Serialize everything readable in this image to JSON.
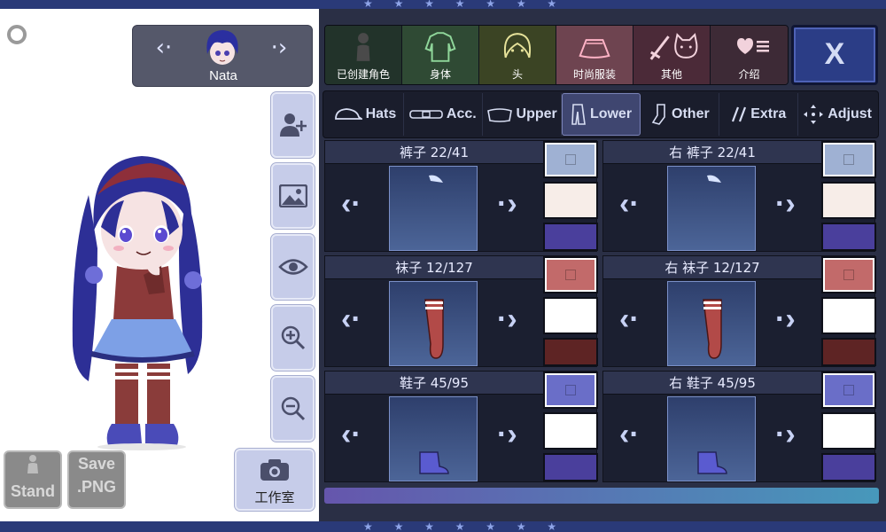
{
  "app": {
    "character_name": "Nata",
    "star_glyphs": "★ ★ ★ ★ ★ ★ ★"
  },
  "stage_buttons": {
    "stand_label": "Stand",
    "save_label_1": "Save",
    "save_label_2": ".PNG",
    "studio_label": "工作室"
  },
  "categories": [
    {
      "label": "已创建角色",
      "icon": "person-silhouette-icon",
      "bg": "#22332a"
    },
    {
      "label": "身体",
      "icon": "body-shirt-icon",
      "bg": "#2f4a34"
    },
    {
      "label": "头",
      "icon": "head-hair-icon",
      "bg": "#3b4424"
    },
    {
      "label": "时尚服装",
      "icon": "skirt-icon",
      "bg": "#6e4450"
    },
    {
      "label": "其他",
      "icon": "sword-cat-icon",
      "bg": "#4b2a38"
    },
    {
      "label": "介绍",
      "icon": "heart-list-icon",
      "bg": "#3d2a36"
    }
  ],
  "close_label": "X",
  "sub_tabs": [
    {
      "label": "Hats",
      "icon": "hat-icon"
    },
    {
      "label": "Acc.",
      "icon": "belt-icon"
    },
    {
      "label": "Upper",
      "icon": "upper-clothing-icon"
    },
    {
      "label": "Lower",
      "icon": "lower-clothing-icon"
    },
    {
      "label": "Other",
      "icon": "sock-icon"
    },
    {
      "label": "Extra",
      "icon": "extra-slashes-icon"
    },
    {
      "label": "Adjust",
      "icon": "adjust-arrows-icon"
    }
  ],
  "items": [
    {
      "label": "裤子 22/41",
      "item": "pants",
      "swatches": [
        "#9fb1d3",
        "#f7ede8",
        "#4a3f9c"
      ]
    },
    {
      "label": "右 裤子 22/41",
      "item": "pants",
      "swatches": [
        "#9fb1d3",
        "#f7ede8",
        "#4a3f9c"
      ]
    },
    {
      "label": "袜子 12/127",
      "item": "sock",
      "swatches": [
        "#c26a6a",
        "#ffffff",
        "#5e2424"
      ]
    },
    {
      "label": "右 袜子 12/127",
      "item": "sock",
      "swatches": [
        "#c26a6a",
        "#ffffff",
        "#5e2424"
      ]
    },
    {
      "label": "鞋子 45/95",
      "item": "shoe",
      "swatches": [
        "#6a6ec8",
        "#ffffff",
        "#4a3f9c"
      ]
    },
    {
      "label": "右 鞋子 45/95",
      "item": "shoe",
      "swatches": [
        "#6a6ec8",
        "#ffffff",
        "#4a3f9c"
      ]
    }
  ]
}
